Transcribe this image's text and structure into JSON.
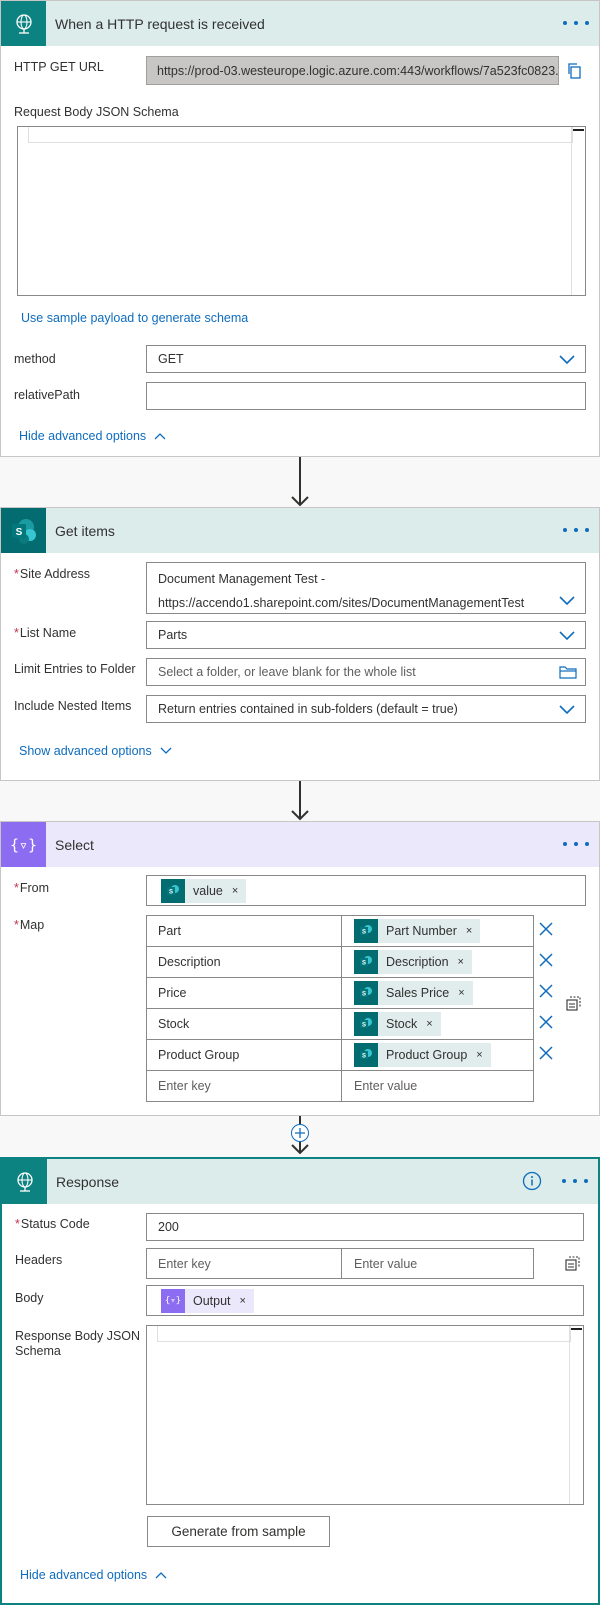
{
  "trigger": {
    "title": "When a HTTP request is received",
    "http_get_url_label": "HTTP GET URL",
    "http_get_url_value": "https://prod-03.westeurope.logic.azure.com:443/workflows/7a523fc0823...",
    "schema_label": "Request Body JSON Schema",
    "sample_payload_link": "Use sample payload to generate schema",
    "method_label": "method",
    "method_value": "GET",
    "relative_path_label": "relativePath",
    "relative_path_value": "",
    "hide_advanced": "Hide advanced options"
  },
  "get_items": {
    "title": "Get items",
    "site_label": "Site Address",
    "site_value_line1": "Document Management Test -",
    "site_value_line2": "https://accendo1.sharepoint.com/sites/DocumentManagementTest",
    "list_label": "List Name",
    "list_value": "Parts",
    "limit_label": "Limit Entries to Folder",
    "limit_placeholder": "Select a folder, or leave blank for the whole list",
    "nested_label": "Include Nested Items",
    "nested_value": "Return entries contained in sub-folders (default = true)",
    "show_advanced": "Show advanced options"
  },
  "select": {
    "title": "Select",
    "from_label": "From",
    "from_token": "value",
    "map_label": "Map",
    "map_rows": [
      {
        "key": "Part",
        "token": "Part Number"
      },
      {
        "key": "Description",
        "token": "Description"
      },
      {
        "key": "Price",
        "token": "Sales Price"
      },
      {
        "key": "Stock",
        "token": "Stock"
      },
      {
        "key": "Product Group",
        "token": "Product Group"
      }
    ],
    "enter_key": "Enter key",
    "enter_value": "Enter value"
  },
  "response": {
    "title": "Response",
    "status_label": "Status Code",
    "status_value": "200",
    "headers_label": "Headers",
    "enter_key": "Enter key",
    "enter_value": "Enter value",
    "body_label": "Body",
    "body_token": "Output",
    "schema_label_line1": "Response Body JSON",
    "schema_label_line2": "Schema",
    "generate_button": "Generate from sample",
    "hide_advanced": "Hide advanced options"
  },
  "token_remove_glyph": "×",
  "colors": {
    "teal_header": "#dbeceb",
    "teal_icon": "#0c8281",
    "sharepoint_icon": "#036c70",
    "purple_header": "#ece8fb",
    "purple_icon": "#8c6cf0",
    "link": "#0f6cbd",
    "selected_border": "#0c8281"
  }
}
